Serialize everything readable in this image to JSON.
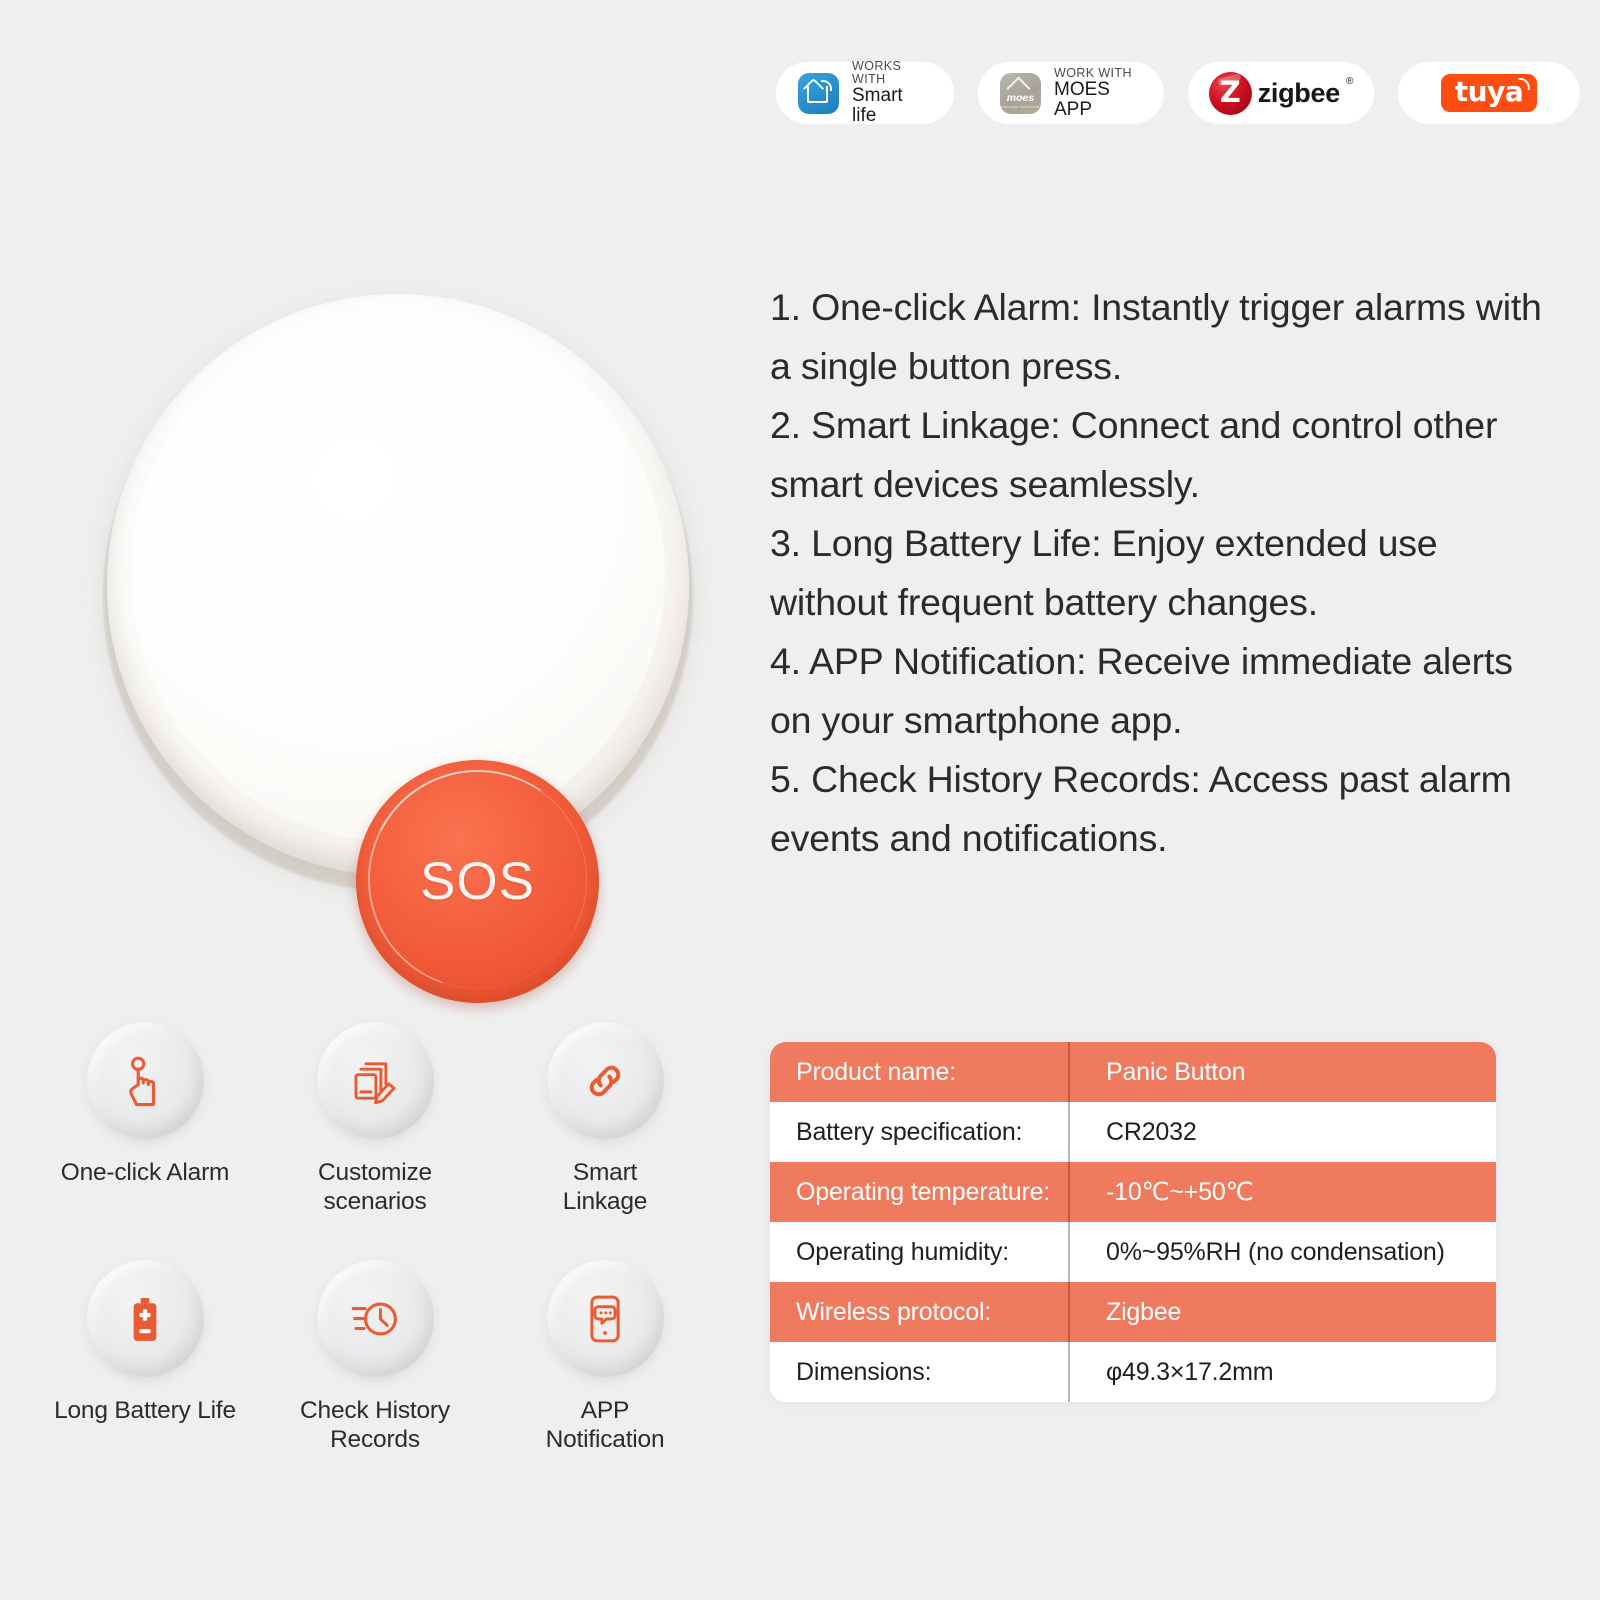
{
  "badges": [
    {
      "id": "smart-life",
      "small": "WORKS WITH",
      "big": "Smart life",
      "icon": "smart-life-logo"
    },
    {
      "id": "moes-app",
      "small": "WORK WITH",
      "big": "MOES APP",
      "icon": "moes-logo",
      "logo_text": "moes",
      "logo_sub": "make your home smart"
    },
    {
      "id": "zigbee",
      "word": "zigbee",
      "mark": "Z",
      "reg": "®",
      "icon": "zigbee-logo"
    },
    {
      "id": "tuya",
      "word": "tuya",
      "icon": "tuya-logo"
    }
  ],
  "product": {
    "button_label": "SOS",
    "colors": {
      "button": "#ef5a35",
      "body": "#fbf9f6"
    }
  },
  "features": {
    "items": [
      "1. One-click Alarm: Instantly trigger alarms with a single button press.",
      "2. Smart Linkage: Connect and control other smart devices seamlessly.",
      "3. Long Battery Life: Enjoy extended use without frequent battery changes.",
      "4. APP Notification: Receive immediate alerts on your smartphone app.",
      "5. Check History Records: Access past alarm events and notifications."
    ]
  },
  "icon_features": [
    {
      "icon": "tap-hand-icon",
      "label": "One-click Alarm"
    },
    {
      "icon": "edit-documents-icon",
      "label": "Customize\nscenarios"
    },
    {
      "icon": "chain-link-icon",
      "label": "Smart\nLinkage"
    },
    {
      "icon": "battery-icon",
      "label": "Long Battery Life"
    },
    {
      "icon": "history-clock-icon",
      "label": "Check History\nRecords"
    },
    {
      "icon": "phone-message-icon",
      "label": "APP\nNotification"
    }
  ],
  "spec_table": {
    "accent_color": "#ef7a5e",
    "rows": [
      {
        "key": "Product name:",
        "value": "Panic Button"
      },
      {
        "key": "Battery specification:",
        "value": "CR2032"
      },
      {
        "key": "Operating temperature:",
        "value": "-10℃~+50℃"
      },
      {
        "key": "Operating humidity:",
        "value": "0%~95%RH (no condensation)"
      },
      {
        "key": "Wireless protocol:",
        "value": "Zigbee"
      },
      {
        "key": "Dimensions:",
        "value": "φ49.3×17.2mm"
      }
    ]
  }
}
